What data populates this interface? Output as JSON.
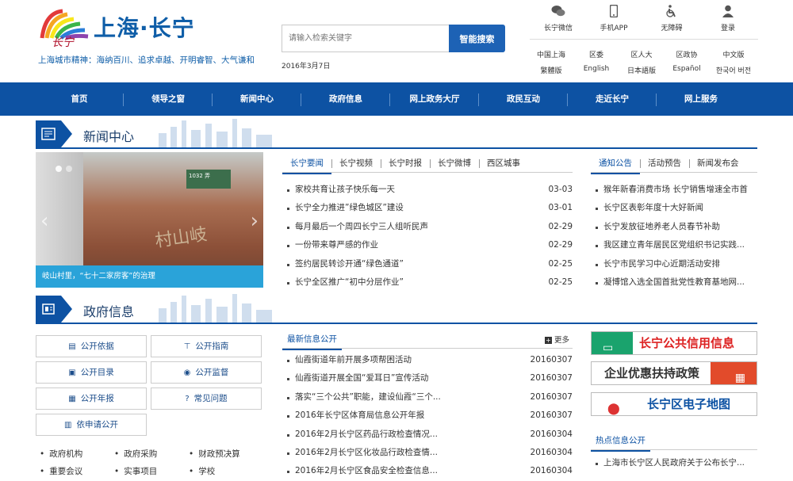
{
  "header": {
    "site_title": "上海·长宁",
    "spirit": "上海城市精神：海纳百川、追求卓越、开明睿智、大气谦和",
    "search_placeholder": "请输入检索关键字",
    "search_button": "智能搜索",
    "date": "2016年3月7日",
    "quick_links": [
      {
        "label": "长宁微信",
        "icon": "wechat-icon"
      },
      {
        "label": "手机APP",
        "icon": "mobile-icon"
      },
      {
        "label": "无障碍",
        "icon": "accessibility-icon"
      },
      {
        "label": "登录",
        "icon": "user-icon"
      }
    ],
    "lang_row1": [
      "中国上海",
      "区委",
      "区人大",
      "区政协",
      "中文版"
    ],
    "lang_row2": [
      "繁體版",
      "English",
      "日本語版",
      "Español",
      "한국어 버전"
    ]
  },
  "nav": [
    "首页",
    "领导之窗",
    "新闻中心",
    "政府信息",
    "网上政务大厅",
    "政民互动",
    "走近长宁",
    "网上服务"
  ],
  "news": {
    "title": "新闻中心",
    "slide_caption": "岐山村里，“七十二家房客”的治理",
    "slide_sign": "1032 弄",
    "slide_letters": "村山岐",
    "tabs": [
      "长宁要闻",
      "长宁视频",
      "长宁时报",
      "长宁微博",
      "西区城事"
    ],
    "items": [
      {
        "title": "家校共育让孩子快乐每一天",
        "date": "03-03"
      },
      {
        "title": "长宁全力推进”绿色城区”建设",
        "date": "03-01"
      },
      {
        "title": "每月最后一个周四长宁三人组听民声",
        "date": "02-29"
      },
      {
        "title": "一份带来尊严感的作业",
        "date": "02-29"
      },
      {
        "title": "签约居民转诊开通“绿色通道”",
        "date": "02-25"
      },
      {
        "title": "长宁全区推广“初中分层作业”",
        "date": "02-25"
      }
    ],
    "notice_tabs": [
      "通知公告",
      "活动预告",
      "新闻发布会"
    ],
    "notices": [
      "猴年新春消费市场 长宁销售增速全市首",
      "长宁区表彰年度十大好新闻",
      "长宁发放征地养老人员春节补助",
      "我区建立青年居民区党组织书记实践...",
      "长宁市民学习中心近期活动安排",
      "凝博馆入选全国首批党性教育基地网..."
    ]
  },
  "gov": {
    "title": "政府信息",
    "buttons": [
      {
        "label": "公开依据",
        "icon": "document-icon"
      },
      {
        "label": "公开指南",
        "icon": "signpost-icon"
      },
      {
        "label": "公开目录",
        "icon": "catalog-icon"
      },
      {
        "label": "公开监督",
        "icon": "eye-icon"
      },
      {
        "label": "公开年报",
        "icon": "calendar-icon"
      },
      {
        "label": "常见问题",
        "icon": "question-icon"
      },
      {
        "label": "依申请公开",
        "icon": "book-icon"
      }
    ],
    "links_row1": [
      "政府机构",
      "政府采购",
      "财政预决算"
    ],
    "links_row2": [
      "重要会议",
      "实事项目",
      "学校"
    ],
    "latest_tab": "最新信息公开",
    "more": "更多",
    "latest": [
      {
        "title": "仙霞街道年前开展多项帮困活动",
        "date": "20160307"
      },
      {
        "title": "仙霞街道开展全国“爱耳日”宣传活动",
        "date": "20160307"
      },
      {
        "title": "落实“三个公共”职能，建设仙霞“三个...",
        "date": "20160307"
      },
      {
        "title": "2016年长宁区体育局信息公开年报",
        "date": "20160307"
      },
      {
        "title": "2016年2月长宁区药品行政检查情况...",
        "date": "20160304"
      },
      {
        "title": "2016年2月长宁区化妆品行政检查情...",
        "date": "20160304"
      },
      {
        "title": "2016年2月长宁区食品安全检查信息...",
        "date": "20160304"
      }
    ],
    "banners": [
      "长宁公共信用信息",
      "企业优惠扶持政策",
      "长宁区电子地图"
    ],
    "hot_tab": "热点信息公开",
    "hot": [
      "上海市长宁区人民政府关于公布长宁..."
    ]
  }
}
